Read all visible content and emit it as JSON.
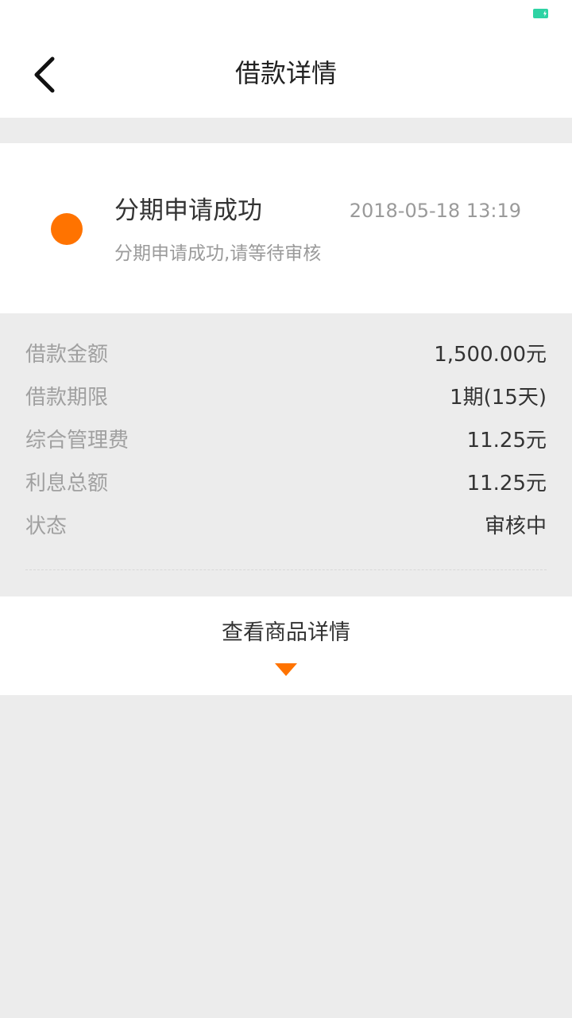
{
  "navbar": {
    "title": "借款详情"
  },
  "status_card": {
    "title": "分期申请成功",
    "time": "2018-05-18 13:19",
    "description": "分期申请成功,请等待审核",
    "accent_color": "#ff7300"
  },
  "details": [
    {
      "label": "借款金额",
      "value": "1,500.00元"
    },
    {
      "label": "借款期限",
      "value": "1期(15天)"
    },
    {
      "label": "综合管理费",
      "value": "11.25元"
    },
    {
      "label": "利息总额",
      "value": "11.25元"
    },
    {
      "label": "状态",
      "value": "审核中"
    }
  ],
  "goods": {
    "label": "查看商品详情"
  },
  "statusbar": {
    "battery_color": "#2ed3a4"
  }
}
